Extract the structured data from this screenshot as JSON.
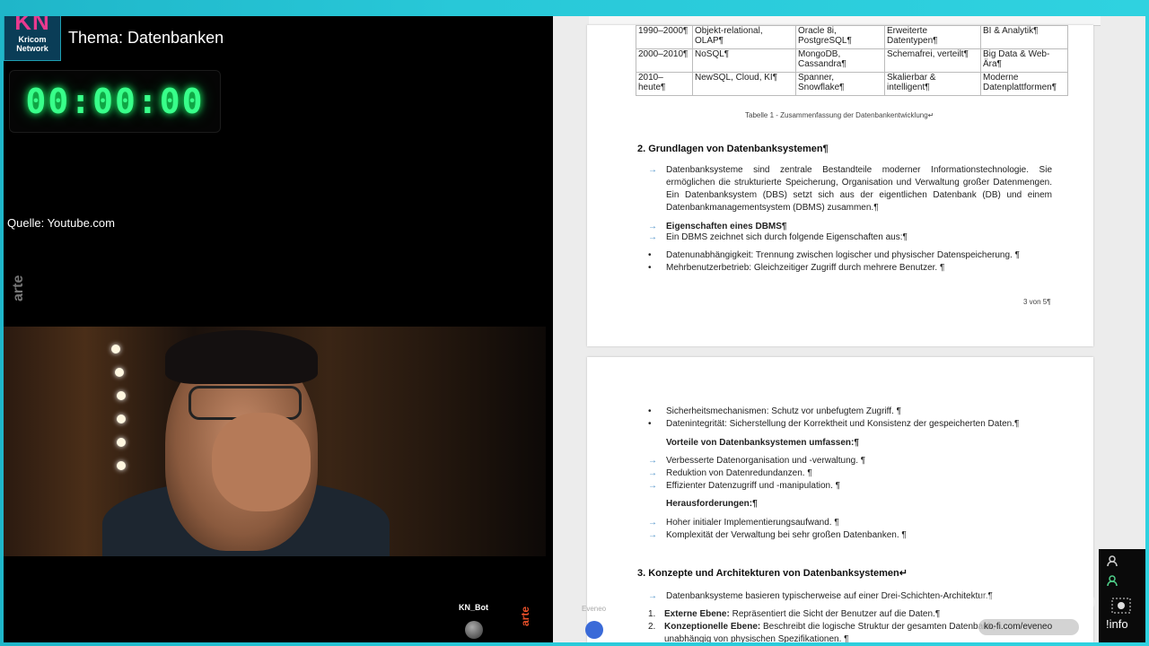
{
  "brand": {
    "logo_big": "KN",
    "logo_line1": "Kricom",
    "logo_line2": "Network"
  },
  "topic": "Thema: Datenbanken",
  "timer": "00:00:00",
  "source": "Quelle: Youtube.com",
  "video": {
    "watermark": "arte",
    "bot_name": "KN_Bot",
    "arte_bottom": "arte",
    "eveneo_label": "Eveneo"
  },
  "document": {
    "table_rows": [
      [
        "1990–2000¶",
        "Objekt-relational, OLAP¶",
        "Oracle 8i, PostgreSQL¶",
        "Erweiterte Datentypen¶",
        "BI & Analytik¶"
      ],
      [
        "2000–2010¶",
        "NoSQL¶",
        "MongoDB, Cassandra¶",
        "Schemafrei, verteilt¶",
        "Big Data & Web-Ära¶"
      ],
      [
        "2010–heute¶",
        "NewSQL, Cloud, KI¶",
        "Spanner, Snowflake¶",
        "Skalierbar & intelligent¶",
        "Moderne Datenplattformen¶"
      ]
    ],
    "caption": "Tabelle 1 - Zusammenfassung der Datenbankentwicklung↵",
    "heading2": "2. Grundlagen von Datenbanksystemen¶",
    "para1": "Datenbanksysteme sind zentrale Bestandteile moderner Informationstechnologie. Sie ermöglichen die strukturierte Speicherung, Organisation und Verwaltung großer Datenmengen. Ein Datenbanksystem (DBS) setzt sich aus der eigentlichen Datenbank (DB) und einem Datenbankmanagementsystem (DBMS) zusammen.¶",
    "props_heading": "Eigenschaften eines DBMS¶",
    "props_intro": "Ein DBMS zeichnet sich durch folgende Eigenschaften aus:¶",
    "props": [
      "Datenunabhängigkeit: Trennung zwischen logischer und physischer Datenspeicherung. ¶",
      "Mehrbenutzerbetrieb: Gleichzeitiger Zugriff durch mehrere Benutzer. ¶"
    ],
    "page_number": "3 von 5¶",
    "props2": [
      "Sicherheitsmechanismen: Schutz vor unbefugtem Zugriff. ¶",
      "Datenintegrität: Sicherstellung der Korrektheit und Konsistenz der gespeicherten Daten.¶"
    ],
    "advantages_heading": "Vorteile von Datenbanksystemen umfassen:¶",
    "advantages": [
      "Verbesserte Datenorganisation und -verwaltung. ¶",
      "Reduktion von Datenredundanzen. ¶",
      "Effizienter Datenzugriff und -manipulation. ¶"
    ],
    "challenges_heading": "Herausforderungen:¶",
    "challenges": [
      "Hoher initialer Implementierungsaufwand. ¶",
      "Komplexität der Verwaltung bei sehr großen Datenbanken. ¶"
    ],
    "heading3": "3. Konzepte und Architekturen von Datenbanksystemen↵",
    "arch_intro": "Datenbanksysteme basieren typischerweise auf einer Drei-Schichten-Architektur.¶",
    "arch_items": [
      {
        "num": "1.",
        "label": "Externe Ebene:",
        "text": " Repräsentiert die Sicht der Benutzer auf die Daten.¶"
      },
      {
        "num": "2.",
        "label": "Konzeptionelle Ebene:",
        "text": " Beschreibt die logische Struktur der gesamten Datenbank,"
      }
    ],
    "arch_cont": "unabhängig von physischen Spezifikationen. ¶"
  },
  "overlay": {
    "kofi_text": "ko-fi.com/eveneo",
    "info": "!info"
  }
}
